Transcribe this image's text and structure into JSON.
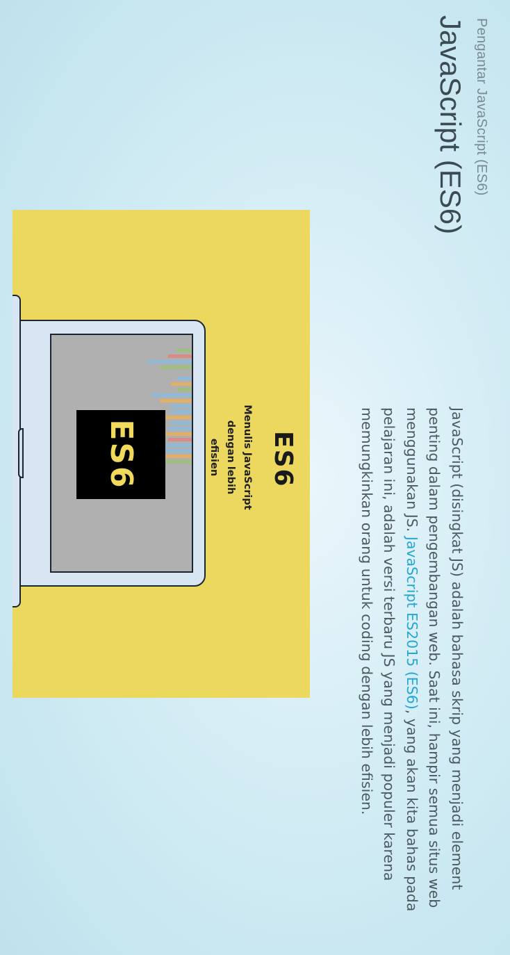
{
  "header": {
    "subtitle": "Pengantar JavaScript (ES6)",
    "title": "JavaScript (ES6)"
  },
  "intro": {
    "text_before": "JavaScript (disingkat JS) adalah bahasa skrip yang menjadi element penting dalam pengembangan web. Saat ini, hampir semua situs web menggunakan JS. ",
    "link_text": "JavaScript ES2015 (ES6)",
    "text_after": ", yang akan kita bahas pada pelajaran ini, adalah versi terbaru JS yang menjadi populer karena memungkinkan orang untuk coding dengan lebih efisien."
  },
  "illustration": {
    "heading": "ES6",
    "tagline": "Menulis JavaScript dengan lebih efisien",
    "screen_badge": "ES6",
    "colors": {
      "background": "#edd85f",
      "laptop": "#d8e6f3",
      "badge_bg": "#000000",
      "badge_text": "#f1d95c"
    }
  },
  "theme": {
    "link_color": "#25a6d4",
    "text_color": "#4d5a61"
  }
}
